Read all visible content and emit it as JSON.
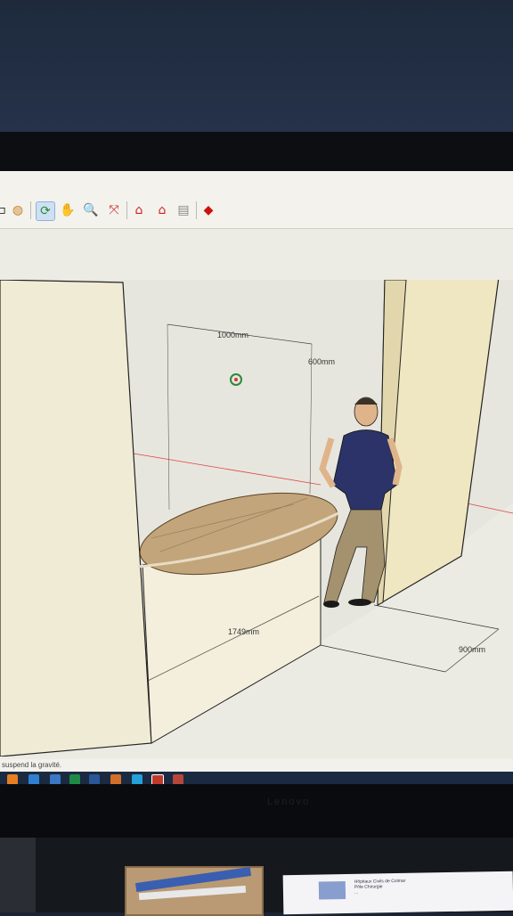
{
  "toolbar": {
    "tools": [
      {
        "icon": "paint-bucket-icon"
      },
      {
        "icon": "orbit-icon",
        "active": true
      },
      {
        "icon": "pan-hand-icon"
      },
      {
        "icon": "zoom-icon"
      },
      {
        "icon": "zoom-extents-icon"
      },
      {
        "icon": "warehouse-icon"
      },
      {
        "icon": "share-model-icon"
      },
      {
        "icon": "layout-icon"
      },
      {
        "icon": "extension-ruby-icon"
      }
    ]
  },
  "viewport": {
    "dimensions": {
      "table_width": "1000mm",
      "table_depth": "600mm",
      "wall_length": "1749mm",
      "door_width": "900mm"
    }
  },
  "status_bar": {
    "text": "suspend la gravité."
  },
  "monitor": {
    "brand": "Lenovo"
  },
  "desk": {
    "paper_text": [
      "Hôpitaux Civils de Colmar",
      "Pôle Chirurgie",
      "..."
    ]
  },
  "colors": {
    "wood": "#c2a57a",
    "panel": "#efe9d0",
    "shirt": "#2c3368",
    "trousers": "#a4916d"
  }
}
